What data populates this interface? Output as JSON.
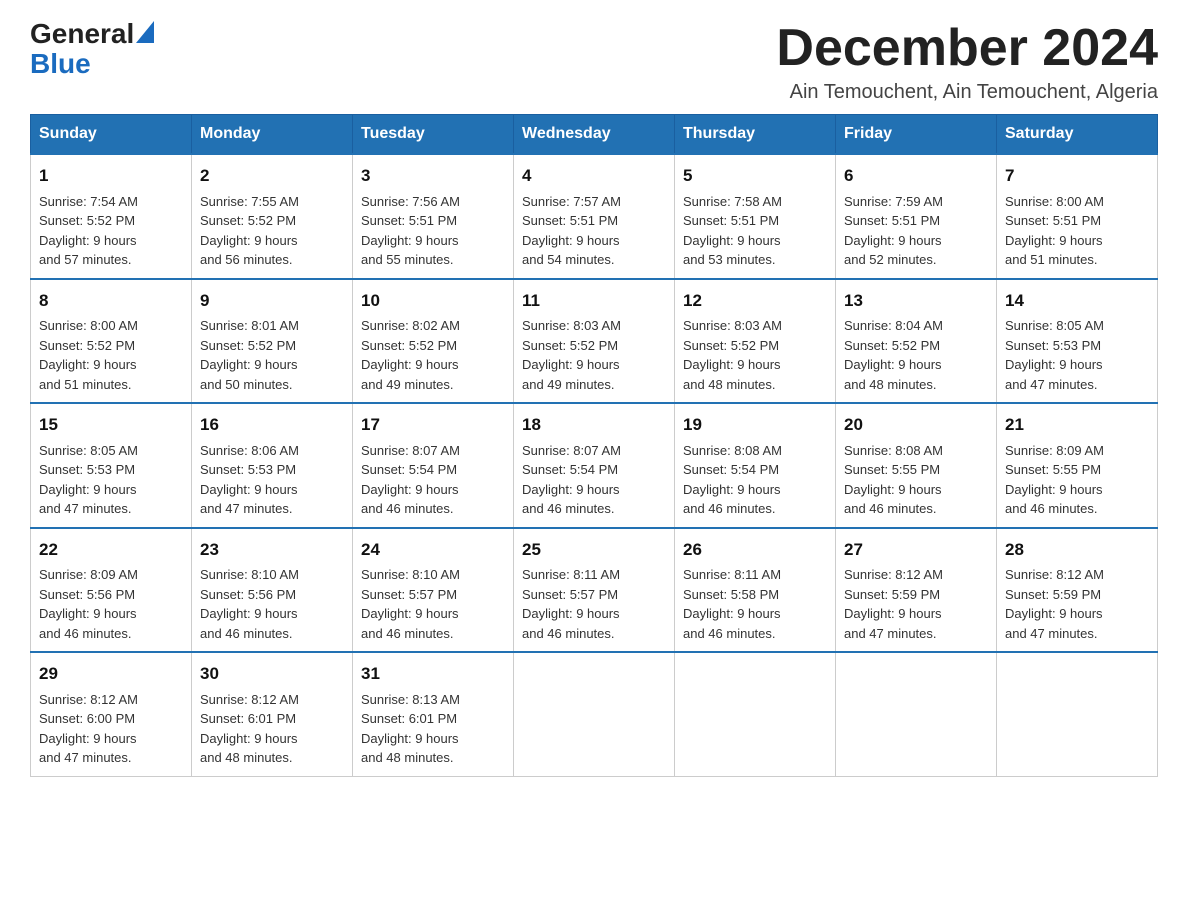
{
  "header": {
    "logo_general": "General",
    "logo_blue": "Blue",
    "month_title": "December 2024",
    "location": "Ain Temouchent, Ain Temouchent, Algeria"
  },
  "weekdays": [
    "Sunday",
    "Monday",
    "Tuesday",
    "Wednesday",
    "Thursday",
    "Friday",
    "Saturday"
  ],
  "weeks": [
    [
      {
        "day": "1",
        "sunrise": "7:54 AM",
        "sunset": "5:52 PM",
        "daylight": "9 hours and 57 minutes."
      },
      {
        "day": "2",
        "sunrise": "7:55 AM",
        "sunset": "5:52 PM",
        "daylight": "9 hours and 56 minutes."
      },
      {
        "day": "3",
        "sunrise": "7:56 AM",
        "sunset": "5:51 PM",
        "daylight": "9 hours and 55 minutes."
      },
      {
        "day": "4",
        "sunrise": "7:57 AM",
        "sunset": "5:51 PM",
        "daylight": "9 hours and 54 minutes."
      },
      {
        "day": "5",
        "sunrise": "7:58 AM",
        "sunset": "5:51 PM",
        "daylight": "9 hours and 53 minutes."
      },
      {
        "day": "6",
        "sunrise": "7:59 AM",
        "sunset": "5:51 PM",
        "daylight": "9 hours and 52 minutes."
      },
      {
        "day": "7",
        "sunrise": "8:00 AM",
        "sunset": "5:51 PM",
        "daylight": "9 hours and 51 minutes."
      }
    ],
    [
      {
        "day": "8",
        "sunrise": "8:00 AM",
        "sunset": "5:52 PM",
        "daylight": "9 hours and 51 minutes."
      },
      {
        "day": "9",
        "sunrise": "8:01 AM",
        "sunset": "5:52 PM",
        "daylight": "9 hours and 50 minutes."
      },
      {
        "day": "10",
        "sunrise": "8:02 AM",
        "sunset": "5:52 PM",
        "daylight": "9 hours and 49 minutes."
      },
      {
        "day": "11",
        "sunrise": "8:03 AM",
        "sunset": "5:52 PM",
        "daylight": "9 hours and 49 minutes."
      },
      {
        "day": "12",
        "sunrise": "8:03 AM",
        "sunset": "5:52 PM",
        "daylight": "9 hours and 48 minutes."
      },
      {
        "day": "13",
        "sunrise": "8:04 AM",
        "sunset": "5:52 PM",
        "daylight": "9 hours and 48 minutes."
      },
      {
        "day": "14",
        "sunrise": "8:05 AM",
        "sunset": "5:53 PM",
        "daylight": "9 hours and 47 minutes."
      }
    ],
    [
      {
        "day": "15",
        "sunrise": "8:05 AM",
        "sunset": "5:53 PM",
        "daylight": "9 hours and 47 minutes."
      },
      {
        "day": "16",
        "sunrise": "8:06 AM",
        "sunset": "5:53 PM",
        "daylight": "9 hours and 47 minutes."
      },
      {
        "day": "17",
        "sunrise": "8:07 AM",
        "sunset": "5:54 PM",
        "daylight": "9 hours and 46 minutes."
      },
      {
        "day": "18",
        "sunrise": "8:07 AM",
        "sunset": "5:54 PM",
        "daylight": "9 hours and 46 minutes."
      },
      {
        "day": "19",
        "sunrise": "8:08 AM",
        "sunset": "5:54 PM",
        "daylight": "9 hours and 46 minutes."
      },
      {
        "day": "20",
        "sunrise": "8:08 AM",
        "sunset": "5:55 PM",
        "daylight": "9 hours and 46 minutes."
      },
      {
        "day": "21",
        "sunrise": "8:09 AM",
        "sunset": "5:55 PM",
        "daylight": "9 hours and 46 minutes."
      }
    ],
    [
      {
        "day": "22",
        "sunrise": "8:09 AM",
        "sunset": "5:56 PM",
        "daylight": "9 hours and 46 minutes."
      },
      {
        "day": "23",
        "sunrise": "8:10 AM",
        "sunset": "5:56 PM",
        "daylight": "9 hours and 46 minutes."
      },
      {
        "day": "24",
        "sunrise": "8:10 AM",
        "sunset": "5:57 PM",
        "daylight": "9 hours and 46 minutes."
      },
      {
        "day": "25",
        "sunrise": "8:11 AM",
        "sunset": "5:57 PM",
        "daylight": "9 hours and 46 minutes."
      },
      {
        "day": "26",
        "sunrise": "8:11 AM",
        "sunset": "5:58 PM",
        "daylight": "9 hours and 46 minutes."
      },
      {
        "day": "27",
        "sunrise": "8:12 AM",
        "sunset": "5:59 PM",
        "daylight": "9 hours and 47 minutes."
      },
      {
        "day": "28",
        "sunrise": "8:12 AM",
        "sunset": "5:59 PM",
        "daylight": "9 hours and 47 minutes."
      }
    ],
    [
      {
        "day": "29",
        "sunrise": "8:12 AM",
        "sunset": "6:00 PM",
        "daylight": "9 hours and 47 minutes."
      },
      {
        "day": "30",
        "sunrise": "8:12 AM",
        "sunset": "6:01 PM",
        "daylight": "9 hours and 48 minutes."
      },
      {
        "day": "31",
        "sunrise": "8:13 AM",
        "sunset": "6:01 PM",
        "daylight": "9 hours and 48 minutes."
      },
      null,
      null,
      null,
      null
    ]
  ],
  "labels": {
    "sunrise": "Sunrise:",
    "sunset": "Sunset:",
    "daylight": "Daylight:"
  }
}
